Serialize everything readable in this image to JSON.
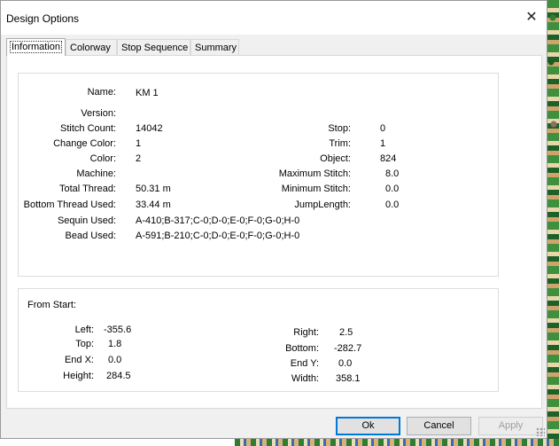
{
  "window": {
    "title": "Design Options"
  },
  "tabs": [
    {
      "label": "Information"
    },
    {
      "label": "Colorway"
    },
    {
      "label": "Stop Sequence"
    },
    {
      "label": "Summary"
    }
  ],
  "info": {
    "name": {
      "label": "Name:",
      "value": "KM 1"
    },
    "version": {
      "label": "Version:",
      "value": ""
    },
    "stitch_count": {
      "label": "Stitch Count:",
      "value": "14042"
    },
    "change_color": {
      "label": "Change Color:",
      "value": "1"
    },
    "color": {
      "label": "Color:",
      "value": "2"
    },
    "machine": {
      "label": "Machine:",
      "value": ""
    },
    "total_thread": {
      "label": "Total Thread:",
      "value": "50.31 m"
    },
    "bottom_thread": {
      "label": "Bottom Thread Used:",
      "value": "33.44 m"
    },
    "sequin_used": {
      "label": "Sequin Used:",
      "value": "A-410;B-317;C-0;D-0;E-0;F-0;G-0;H-0"
    },
    "bead_used": {
      "label": "Bead Used:",
      "value": "A-591;B-210;C-0;D-0;E-0;F-0;G-0;H-0"
    },
    "stop": {
      "label": "Stop:",
      "value": "0"
    },
    "trim": {
      "label": "Trim:",
      "value": "1"
    },
    "object": {
      "label": "Object:",
      "value": "824"
    },
    "max_stitch": {
      "label": "Maximum Stitch:",
      "value": "8.0"
    },
    "min_stitch": {
      "label": "Minimum Stitch:",
      "value": "0.0"
    },
    "jump_length": {
      "label": "JumpLength:",
      "value": "0.0"
    }
  },
  "from_start": {
    "title": "From Start:",
    "left": {
      "label": "Left:",
      "value": "-355.6"
    },
    "top": {
      "label": "Top:",
      "value": "1.8"
    },
    "end_x": {
      "label": "End X:",
      "value": "0.0"
    },
    "height": {
      "label": "Height:",
      "value": "284.5"
    },
    "right": {
      "label": "Right:",
      "value": "2.5"
    },
    "bottom": {
      "label": "Bottom:",
      "value": "-282.7"
    },
    "end_y": {
      "label": "End Y:",
      "value": "0.0"
    },
    "width": {
      "label": "Width:",
      "value": "358.1"
    }
  },
  "buttons": {
    "ok": "Ok",
    "cancel": "Cancel",
    "apply": "Apply"
  },
  "colors": {
    "accent": "#0078d7",
    "dialog_bg": "#f0f0f0",
    "panel_bg": "#ffffff"
  },
  "icons": {
    "close": "close-icon"
  }
}
